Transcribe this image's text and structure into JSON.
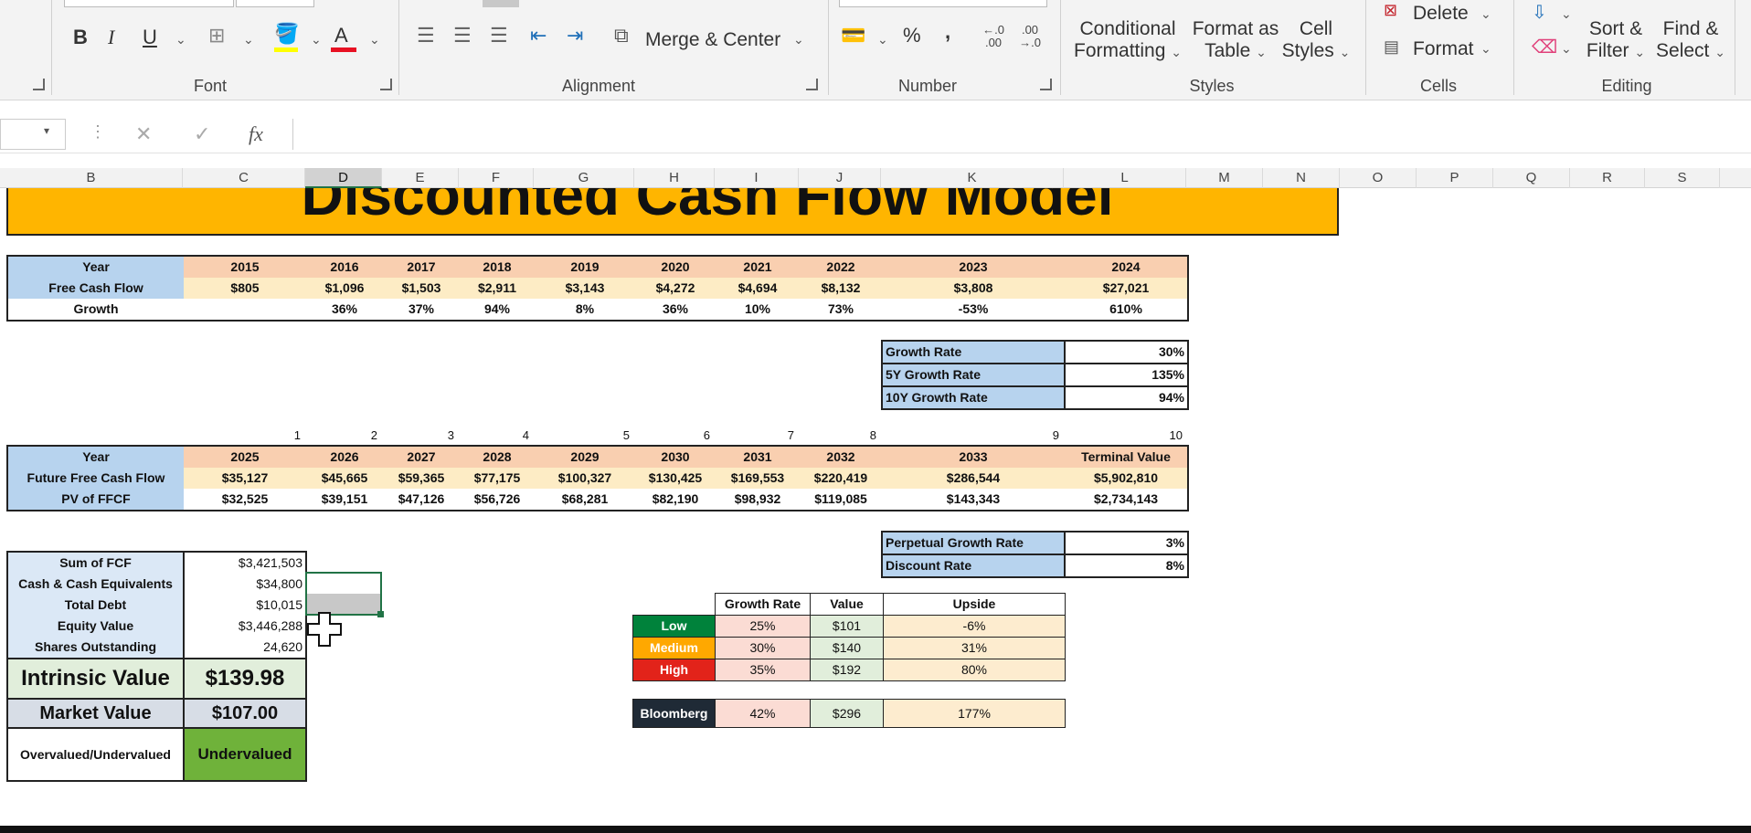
{
  "ribbon": {
    "groups": {
      "font": "Font",
      "alignment": "Alignment",
      "number": "Number",
      "styles": "Styles",
      "cells": "Cells",
      "editing": "Editing"
    },
    "font_buttons": {
      "bold": "B",
      "italic": "I",
      "underline": "U",
      "font_color_letter": "A"
    },
    "merge_center": "Merge & Center",
    "percent": "%",
    "comma": ",",
    "dec_inc": "←.0\n.00",
    "dec_dec": ".00\n→.0",
    "conditional_formatting": [
      "Conditional",
      "Formatting"
    ],
    "format_as_table": [
      "Format as",
      "Table"
    ],
    "cell_styles": [
      "Cell",
      "Styles"
    ],
    "delete": "Delete",
    "format": "Format",
    "sort_filter": [
      "Sort &",
      "Filter"
    ],
    "find_select": [
      "Find &",
      "Select"
    ],
    "colors": {
      "fill": "#ffff00",
      "font": "#e81123"
    }
  },
  "formula_bar": {
    "fx": "fx",
    "cancel": "✕",
    "enter": "✓",
    "value": ""
  },
  "columns": [
    "B",
    "C",
    "D",
    "E",
    "F",
    "G",
    "H",
    "I",
    "J",
    "K",
    "L",
    "M",
    "N",
    "O",
    "P",
    "Q",
    "R",
    "S"
  ],
  "selected_column": "D",
  "title": "Discounted Cash Flow Model",
  "historical": {
    "labels": [
      "Year",
      "Free Cash Flow",
      "Growth"
    ],
    "years": [
      "2015",
      "2016",
      "2017",
      "2018",
      "2019",
      "2020",
      "2021",
      "2022",
      "2023",
      "2024"
    ],
    "fcf": [
      "$805",
      "$1,096",
      "$1,503",
      "$2,911",
      "$3,143",
      "$4,272",
      "$4,694",
      "$8,132",
      "$3,808",
      "$27,021"
    ],
    "growth": [
      "",
      "36%",
      "37%",
      "94%",
      "8%",
      "36%",
      "10%",
      "73%",
      "-53%",
      "610%"
    ]
  },
  "growth_rates": [
    {
      "label": "Growth Rate",
      "value": "30%"
    },
    {
      "label": "5Y Growth Rate",
      "value": "135%"
    },
    {
      "label": "10Y Growth Rate",
      "value": "94%"
    }
  ],
  "period_numbers": [
    "1",
    "2",
    "3",
    "4",
    "5",
    "6",
    "7",
    "8",
    "9",
    "10"
  ],
  "projection": {
    "labels": [
      "Year",
      "Future Free Cash Flow",
      "PV of FFCF"
    ],
    "years": [
      "2025",
      "2026",
      "2027",
      "2028",
      "2029",
      "2030",
      "2031",
      "2032",
      "2033",
      "Terminal Value"
    ],
    "ffcf": [
      "$35,127",
      "$45,665",
      "$59,365",
      "$77,175",
      "$100,327",
      "$130,425",
      "$169,553",
      "$220,419",
      "$286,544",
      "$5,902,810"
    ],
    "pv": [
      "$32,525",
      "$39,151",
      "$47,126",
      "$56,726",
      "$68,281",
      "$82,190",
      "$98,932",
      "$119,085",
      "$143,343",
      "$2,734,143"
    ]
  },
  "rates": [
    {
      "label": "Perpetual Growth Rate",
      "value": "3%"
    },
    {
      "label": "Discount Rate",
      "value": "8%"
    }
  ],
  "valuation": [
    {
      "label": "Sum of FCF",
      "value": "$3,421,503"
    },
    {
      "label": "Cash & Cash Equivalents",
      "value": "$34,800"
    },
    {
      "label": "Total Debt",
      "value": "$10,015"
    },
    {
      "label": "Equity Value",
      "value": "$3,446,288"
    },
    {
      "label": "Shares Outstanding",
      "value": "24,620"
    }
  ],
  "summary": {
    "intrinsic_label": "Intrinsic Value",
    "intrinsic_value": "$139.98",
    "market_label": "Market Value",
    "market_value": "$107.00",
    "verdict_label": "Overvalued/Undervalued",
    "verdict_value": "Undervalued"
  },
  "sensitivity": {
    "headers": [
      "Growth Rate",
      "Value",
      "Upside"
    ],
    "rows": [
      {
        "label": "Low",
        "color": "#00823b",
        "growth": "25%",
        "value": "$101",
        "upside": "-6%"
      },
      {
        "label": "Medium",
        "color": "#ffa800",
        "growth": "30%",
        "value": "$140",
        "upside": "31%"
      },
      {
        "label": "High",
        "color": "#e2231a",
        "growth": "35%",
        "value": "$192",
        "upside": "80%"
      }
    ],
    "bloomberg": {
      "label": "Bloomberg",
      "color": "#1f2a36",
      "growth": "42%",
      "value": "$296",
      "upside": "177%"
    }
  }
}
